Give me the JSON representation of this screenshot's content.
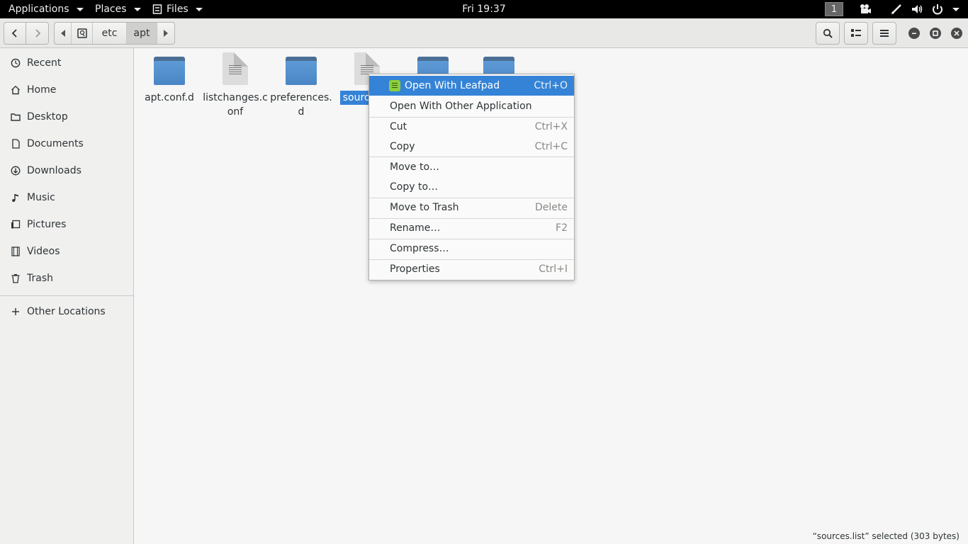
{
  "topbar": {
    "applications_label": "Applications",
    "places_label": "Places",
    "files_label": "Files",
    "clock": "Fri 19:37",
    "workspace": "1"
  },
  "header": {
    "path": [
      "etc",
      "apt"
    ]
  },
  "sidebar": {
    "items": [
      {
        "label": "Recent",
        "icon": "clock-icon"
      },
      {
        "label": "Home",
        "icon": "home-icon"
      },
      {
        "label": "Desktop",
        "icon": "folder-icon"
      },
      {
        "label": "Documents",
        "icon": "document-icon"
      },
      {
        "label": "Downloads",
        "icon": "download-icon"
      },
      {
        "label": "Music",
        "icon": "music-icon"
      },
      {
        "label": "Pictures",
        "icon": "pictures-icon"
      },
      {
        "label": "Videos",
        "icon": "video-icon"
      },
      {
        "label": "Trash",
        "icon": "trash-icon"
      }
    ],
    "other_locations": "Other Locations"
  },
  "files": [
    {
      "name": "apt.conf.d",
      "type": "folder"
    },
    {
      "name": "listchanges.conf",
      "type": "document"
    },
    {
      "name": "preferences.d",
      "type": "folder"
    },
    {
      "name": "source",
      "type": "document",
      "selected": true
    },
    {
      "name": "",
      "type": "folder"
    },
    {
      "name": "",
      "type": "folder"
    }
  ],
  "context_menu": {
    "items": [
      {
        "label": "Open With Leafpad",
        "shortcut": "Ctrl+O"
      },
      {
        "label": "Open With Other Application",
        "shortcut": ""
      },
      {
        "label": "Cut",
        "shortcut": "Ctrl+X"
      },
      {
        "label": "Copy",
        "shortcut": "Ctrl+C"
      },
      {
        "label": "Move to…",
        "shortcut": ""
      },
      {
        "label": "Copy to…",
        "shortcut": ""
      },
      {
        "label": "Move to Trash",
        "shortcut": "Delete"
      },
      {
        "label": "Rename…",
        "shortcut": "F2"
      },
      {
        "label": "Compress…",
        "shortcut": ""
      },
      {
        "label": "Properties",
        "shortcut": "Ctrl+I"
      }
    ]
  },
  "status": {
    "text": "“sources.list” selected  (303 bytes)"
  },
  "colors": {
    "selection": "#3583d6",
    "folder": "#5e9ad6",
    "topbar": "#000000"
  }
}
